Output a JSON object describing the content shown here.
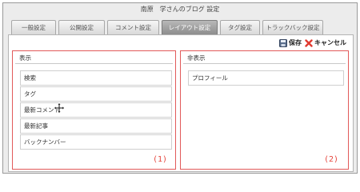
{
  "window": {
    "title": "南原　学さんのブログ 設定"
  },
  "tabs": [
    {
      "label": "一般設定",
      "active": false
    },
    {
      "label": "公開設定",
      "active": false
    },
    {
      "label": "コメント設定",
      "active": false
    },
    {
      "label": "レイアウト設定",
      "active": true
    },
    {
      "label": "タグ設定",
      "active": false
    },
    {
      "label": "トラックバック設定",
      "active": false
    }
  ],
  "toolbar": {
    "save_label": "保存",
    "cancel_label": "キャンセル",
    "save_icon": "floppy-disk-icon",
    "cancel_icon": "red-x-icon"
  },
  "columns": {
    "shown": {
      "header": "表示",
      "marker": "(1)",
      "items": [
        "検索",
        "タグ",
        "最新コメント",
        "最新記事",
        "バックナンバー"
      ]
    },
    "hidden": {
      "header": "非表示",
      "marker": "(2)",
      "items": [
        "プロフィール"
      ]
    }
  },
  "colors": {
    "accent_red": "#e25a5a",
    "marker_red": "#e6473f",
    "active_tab": "#9a9a9a"
  }
}
